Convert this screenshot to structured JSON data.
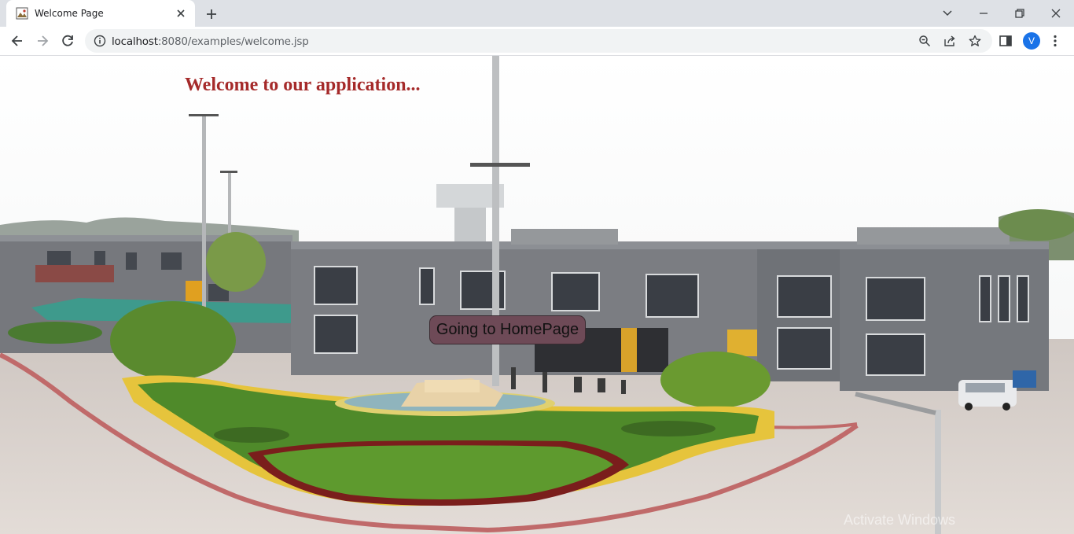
{
  "browser": {
    "tab_title": "Welcome Page",
    "url_host": "localhost",
    "url_rest": ":8080/examples/welcome.jsp",
    "profile_initial": "V",
    "accent_color": "#1a73e8"
  },
  "icons": {
    "tab": [
      "favicon-icon",
      "close-icon",
      "plus-icon"
    ],
    "window": [
      "chevron-down-icon",
      "minimize-icon",
      "restore-icon",
      "close-window-icon"
    ],
    "nav": [
      "back-icon",
      "forward-icon",
      "reload-icon",
      "info-icon"
    ],
    "toolbar": [
      "zoom-icon",
      "share-icon",
      "star-icon",
      "sidebar-icon",
      "more-vert-icon"
    ]
  },
  "page": {
    "heading": "Welcome to our application...",
    "heading_color": "#a52a2a",
    "button_label": "Going to HomePage",
    "button_color": "#6e4a57"
  },
  "os": {
    "watermark": "Activate Windows"
  }
}
